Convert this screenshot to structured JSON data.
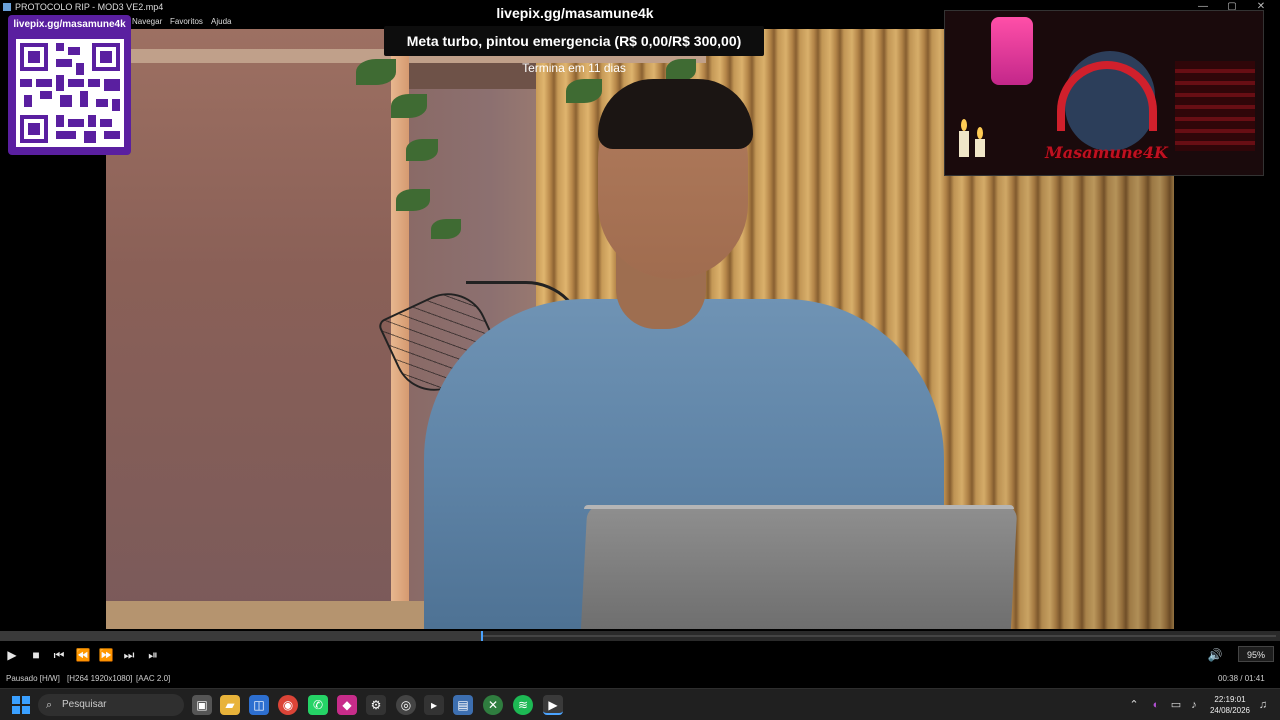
{
  "window": {
    "title": "PROTOCOLO RIP - MOD3 VE2.mp4",
    "controls": {
      "minimize": "—",
      "maximize": "▢",
      "close": "✕"
    }
  },
  "menu": {
    "items": [
      "Navegar",
      "Favoritos",
      "Ajuda"
    ]
  },
  "overlay": {
    "url": "livepix.gg/masamune4k",
    "goal": "Meta turbo, pintou emergencia (R$ 0,00/R$ 300,00)",
    "goal_sub": "Termina em 11 dias",
    "qr_label": "livepix.gg/masamune4k",
    "webcam_logo": "Masamune4K"
  },
  "playback": {
    "progress": 0.376,
    "position": "00:38",
    "duration": "01:41",
    "volume": "95%"
  },
  "status": {
    "state": "Pausado [H/W]",
    "video": "[H264 1920x1080]",
    "audio": "[AAC 2.0]",
    "time": "00:38 / 01:41"
  },
  "taskbar": {
    "search_placeholder": "Pesquisar",
    "time": "22:19:01",
    "date": "24/08/2026"
  },
  "icons": {
    "play": "▶",
    "stop": "■",
    "prev": "⏮",
    "rewind": "⏪",
    "forward": "⏩",
    "next": "⏭",
    "frame": "⏯",
    "volume": "🔊",
    "search": "⌕"
  },
  "colors": {
    "accent": "#4aa3ff",
    "qr_card": "#5a1fa0",
    "taskbar": "#202020"
  }
}
